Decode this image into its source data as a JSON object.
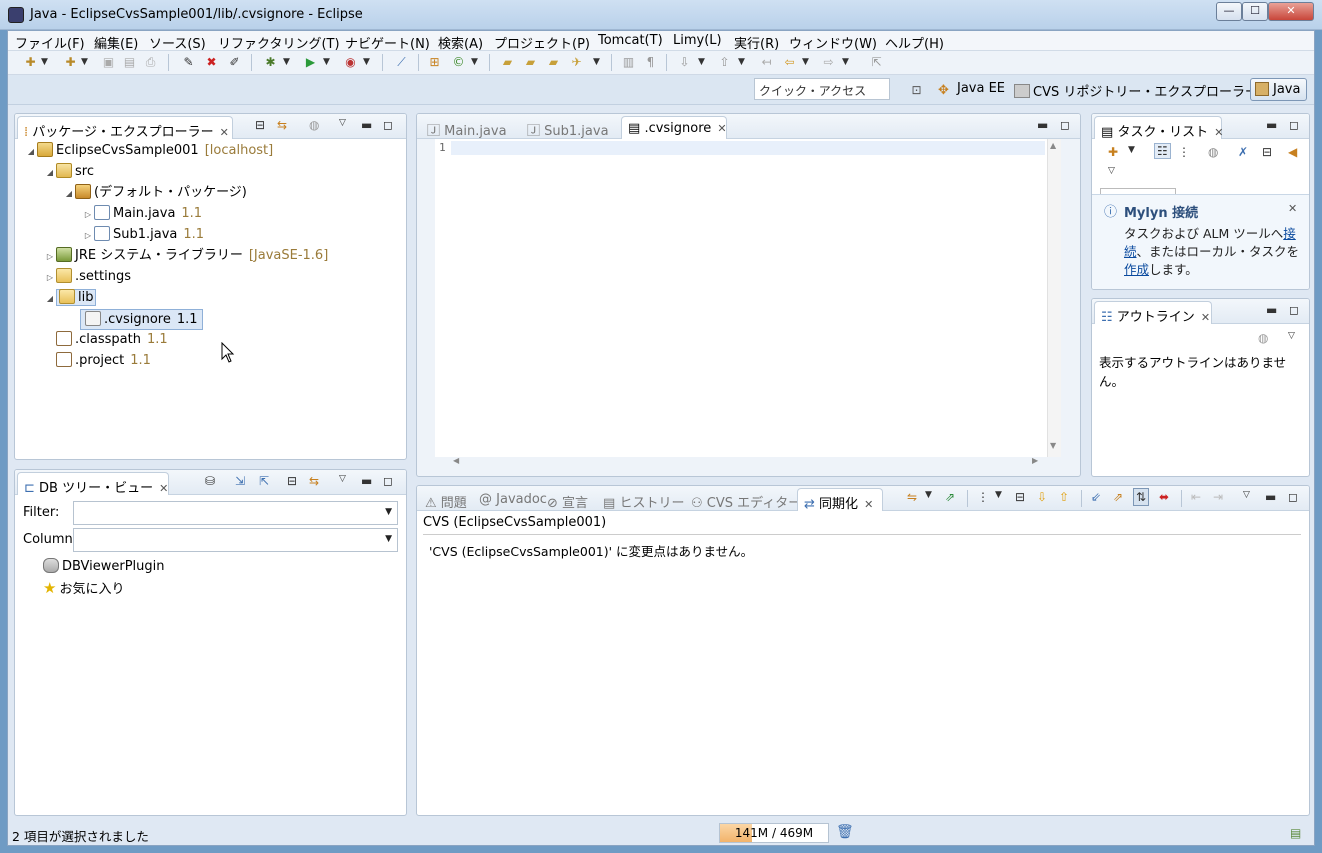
{
  "window": {
    "title": "Java - EclipseCvsSample001/lib/.cvsignore - Eclipse",
    "minimize": "—",
    "maximize": "☐",
    "close": "✕"
  },
  "menu": [
    "ファイル(F)",
    "編集(E)",
    "ソース(S)",
    "リファクタリング(T)",
    "ナビゲート(N)",
    "検索(A)",
    "プロジェクト(P)",
    "Tomcat(T)",
    "Limy(L)",
    "実行(R)",
    "ウィンドウ(W)",
    "ヘルプ(H)"
  ],
  "quick_access": {
    "placeholder": "クイック・アクセス"
  },
  "perspectives": {
    "java_ee": "Java EE",
    "cvs": "CVS リポジトリー・エクスプローラー",
    "java": "Java"
  },
  "package_explorer": {
    "title": "パッケージ・エクスプローラー",
    "rows": [
      {
        "label": "EclipseCvsSample001",
        "suffix": "[localhost]"
      },
      {
        "label": "src",
        "suffix": ""
      },
      {
        "label": "(デフォルト・パッケージ)",
        "suffix": ""
      },
      {
        "label": "Main.java",
        "suffix": "1.1"
      },
      {
        "label": "Sub1.java",
        "suffix": "1.1"
      },
      {
        "label": "JRE システム・ライブラリー",
        "suffix": "[JavaSE-1.6]"
      },
      {
        "label": ".settings",
        "suffix": ""
      },
      {
        "label": "lib",
        "suffix": ""
      },
      {
        "label": ".cvsignore",
        "suffix": "1.1"
      },
      {
        "label": ".classpath",
        "suffix": "1.1"
      },
      {
        "label": ".project",
        "suffix": "1.1"
      }
    ]
  },
  "editor": {
    "tabs": [
      "Main.java",
      "Sub1.java",
      ".cvsignore"
    ],
    "line_number": "1"
  },
  "task_list": {
    "title": "タスク・リスト"
  },
  "mylyn": {
    "title": "Mylyn 接続",
    "text1": "タスクおよび ALM ツールへ",
    "link1": "接続",
    "text2": "、またはローカル・タスクを",
    "link2": "作成",
    "text3": "します。"
  },
  "outline": {
    "title": "アウトライン",
    "empty": "表示するアウトラインはありません。"
  },
  "db_tree": {
    "title": "DB ツリー・ビュー",
    "filter_label": "Filter:",
    "column_label": "Column:",
    "items": [
      "DBViewerPlugin",
      "お気に入り"
    ]
  },
  "bottom_tabs": [
    "問題",
    "Javadoc",
    "宣言",
    "ヒストリー",
    "CVS エディター",
    "同期化"
  ],
  "sync": {
    "header": "CVS (EclipseCvsSample001)",
    "message": "'CVS (EclipseCvsSample001)' に変更点はありません。"
  },
  "status": {
    "selection": "2 項目が選択されました",
    "heap_used": "141M",
    "heap_total": "469M",
    "heap_text": "141M / 469M",
    "heap_fraction": 0.3
  },
  "colors": {
    "accent": "#3d6fb0",
    "link": "#0a4a9e",
    "revision": "#9a7b3a"
  }
}
